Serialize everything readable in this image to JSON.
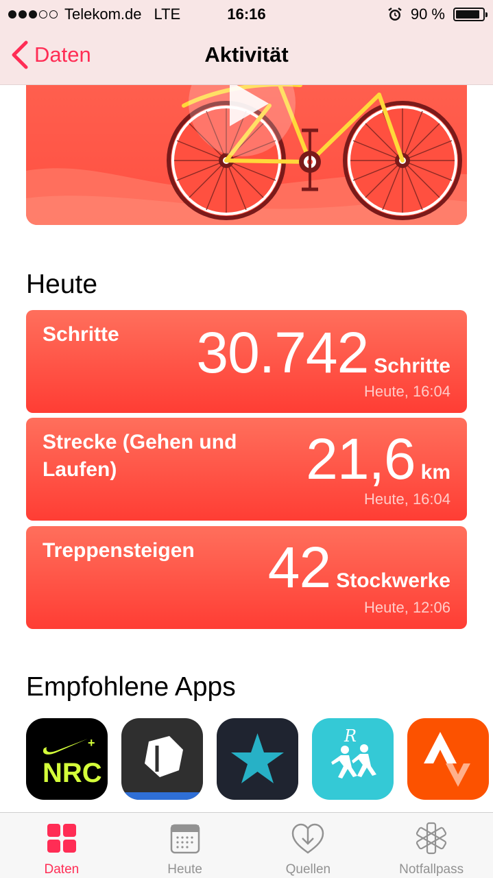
{
  "status_bar": {
    "carrier": "Telekom.de",
    "network": "LTE",
    "time": "16:16",
    "battery": "90 %",
    "battery_level": 0.9,
    "signal_bars_filled": 3,
    "signal_bars_total": 5
  },
  "nav": {
    "back_label": "Daten",
    "title": "Aktivität"
  },
  "hero": {
    "icons": [
      "bicycle-illustration",
      "play-icon"
    ],
    "colors": {
      "background": "#ff5143",
      "bike_frame": "#ffd83a"
    }
  },
  "today": {
    "title": "Heute",
    "metrics": [
      {
        "label": "Schritte",
        "value": "30.742",
        "unit": "Schritte",
        "timestamp": "Heute, 16:04"
      },
      {
        "label": "Strecke (Gehen und Laufen)",
        "value": "21,6",
        "unit": "km",
        "timestamp": "Heute, 16:04"
      },
      {
        "label": "Treppensteigen",
        "value": "42",
        "unit": "Stockwerke",
        "timestamp": "Heute, 12:06"
      }
    ]
  },
  "recommended": {
    "title": "Empfohlene Apps",
    "apps": [
      {
        "icon": "nike-run-club-icon",
        "text": "NRC",
        "labels_clipped": true
      },
      {
        "icon": "freeletics-icon"
      },
      {
        "icon": "star-app-icon"
      },
      {
        "icon": "runtastic-runners-icon"
      },
      {
        "icon": "strava-icon"
      }
    ]
  },
  "tabbar": {
    "tabs": [
      {
        "label": "Daten",
        "icon": "grid-icon",
        "active": true
      },
      {
        "label": "Heute",
        "icon": "calendar-icon",
        "active": false
      },
      {
        "label": "Quellen",
        "icon": "heart-download-icon",
        "active": false
      },
      {
        "label": "Notfallpass",
        "icon": "asterisk-icon",
        "active": false
      }
    ]
  },
  "colors": {
    "accent": "#ff2d55",
    "card_gradient_top": "#ff6f5c",
    "card_gradient_bottom": "#ff3d34",
    "tab_inactive": "#929292"
  }
}
